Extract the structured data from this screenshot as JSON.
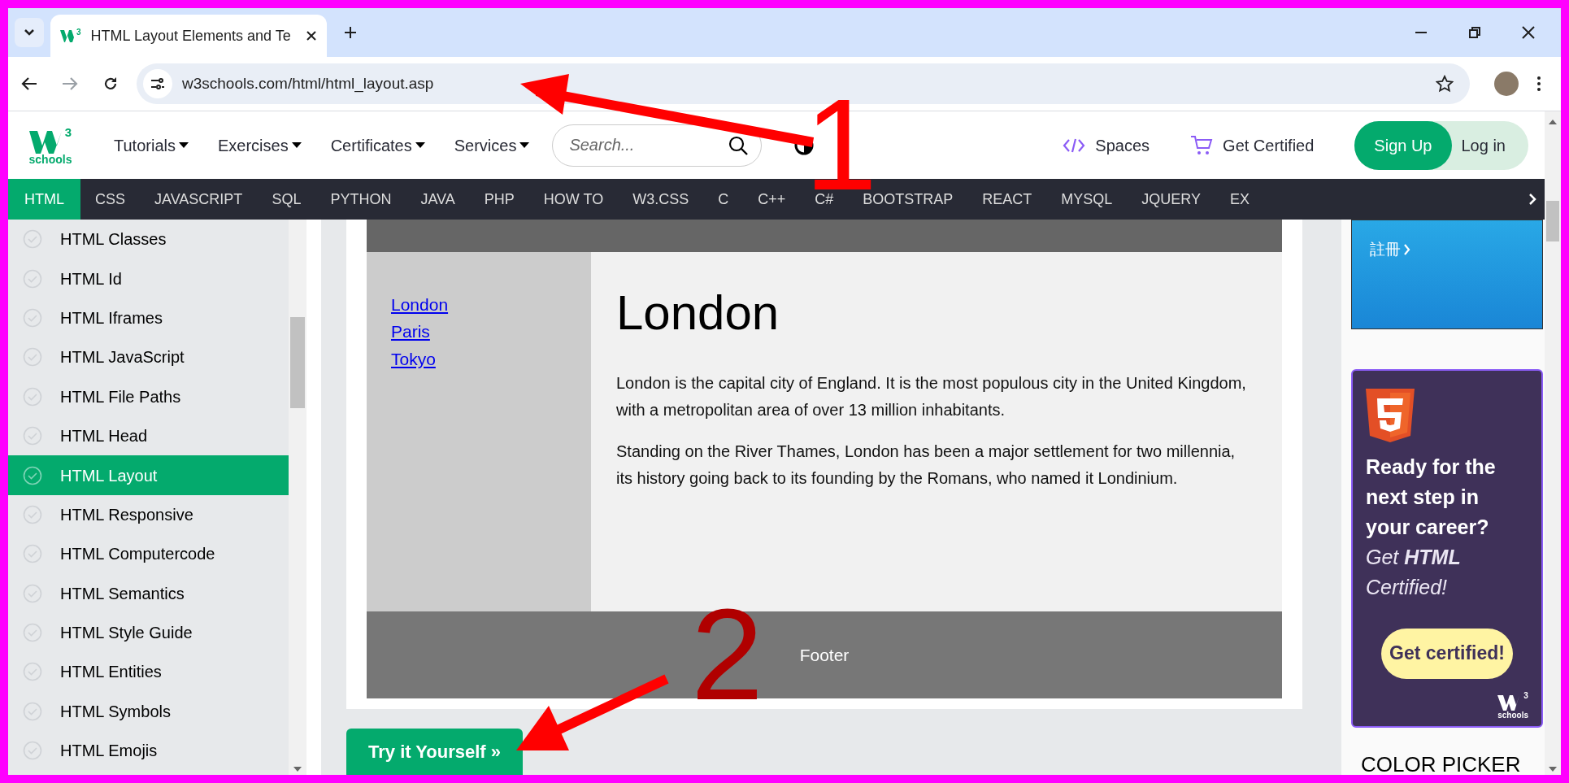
{
  "browser": {
    "tab_logo_mark": "3",
    "tab_title": "HTML Layout Elements and Te",
    "url": "w3schools.com/html/html_layout.asp"
  },
  "site_nav": {
    "logo_mark": "3",
    "logo_text": "schools",
    "menus": [
      "Tutorials",
      "Exercises",
      "Certificates",
      "Services"
    ],
    "search": {
      "placeholder": "Search..."
    },
    "spaces": "Spaces",
    "get_certified": "Get Certified",
    "sign_up": "Sign Up",
    "log_in": "Log in"
  },
  "subjects": [
    {
      "label": "HTML",
      "selected": true
    },
    {
      "label": "CSS",
      "selected": false
    },
    {
      "label": "JAVASCRIPT",
      "selected": false
    },
    {
      "label": "SQL",
      "selected": false
    },
    {
      "label": "PYTHON",
      "selected": false
    },
    {
      "label": "JAVA",
      "selected": false
    },
    {
      "label": "PHP",
      "selected": false
    },
    {
      "label": "HOW TO",
      "selected": false
    },
    {
      "label": "W3.CSS",
      "selected": false
    },
    {
      "label": "C",
      "selected": false
    },
    {
      "label": "C++",
      "selected": false
    },
    {
      "label": "C#",
      "selected": false
    },
    {
      "label": "BOOTSTRAP",
      "selected": false
    },
    {
      "label": "REACT",
      "selected": false
    },
    {
      "label": "MYSQL",
      "selected": false
    },
    {
      "label": "JQUERY",
      "selected": false
    },
    {
      "label": "EX",
      "selected": false
    }
  ],
  "sidebar": {
    "items": [
      {
        "label": "HTML Classes",
        "selected": false
      },
      {
        "label": "HTML Id",
        "selected": false
      },
      {
        "label": "HTML Iframes",
        "selected": false
      },
      {
        "label": "HTML JavaScript",
        "selected": false
      },
      {
        "label": "HTML File Paths",
        "selected": false
      },
      {
        "label": "HTML Head",
        "selected": false
      },
      {
        "label": "HTML Layout",
        "selected": true
      },
      {
        "label": "HTML Responsive",
        "selected": false
      },
      {
        "label": "HTML Computercode",
        "selected": false
      },
      {
        "label": "HTML Semantics",
        "selected": false
      },
      {
        "label": "HTML Style Guide",
        "selected": false
      },
      {
        "label": "HTML Entities",
        "selected": false
      },
      {
        "label": "HTML Symbols",
        "selected": false
      },
      {
        "label": "HTML Emojis",
        "selected": false
      }
    ]
  },
  "example": {
    "links": [
      "London",
      "Paris",
      "Tokyo"
    ],
    "heading": "London",
    "paragraphs": [
      "London is the capital city of England. It is the most populous city in the United Kingdom, with a metropolitan area of over 13 million inhabitants.",
      "Standing on the River Thames, London has been a major settlement for two millennia, its history going back to its founding by the Romans, who named it Londinium."
    ],
    "footer": "Footer"
  },
  "try_button": "Try it Yourself »",
  "ads": {
    "signup_link": "註冊",
    "headline": "Ready for the next step in your career?",
    "subline": "Get **HTML** Certified!",
    "button": "Get certified!",
    "logo_mark": "3",
    "logo_text": "schools"
  },
  "color_picker": "COLOR PICKER",
  "annotations": [
    {
      "label": "1"
    },
    {
      "label": "2"
    }
  ]
}
